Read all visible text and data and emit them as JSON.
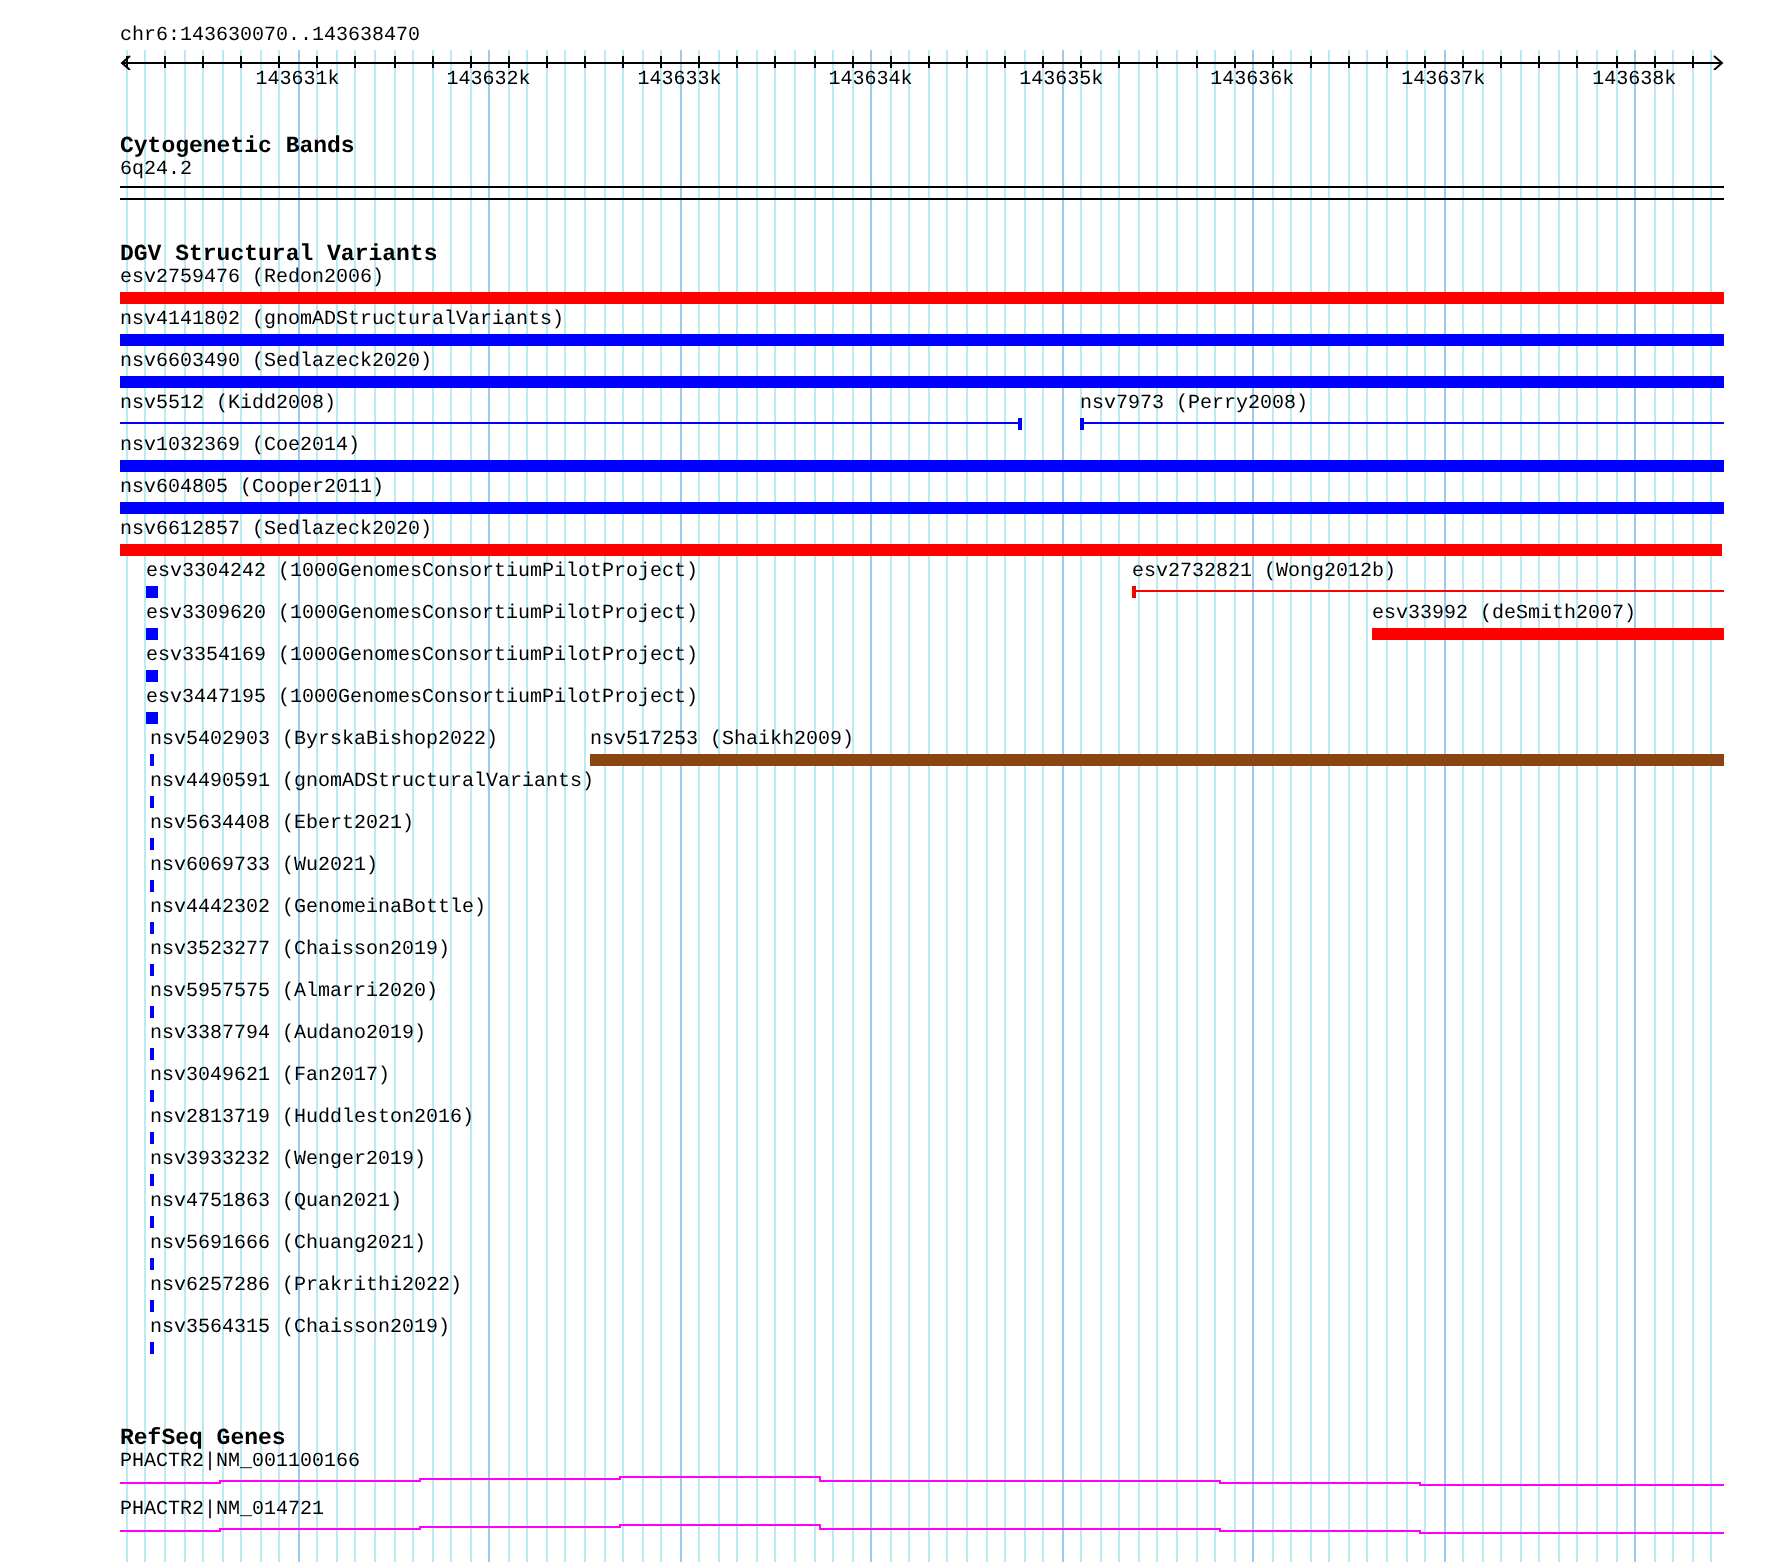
{
  "ruler": {
    "location": "chr6:143630070..143638470",
    "ticks": [
      "143631k",
      "143632k",
      "143633k",
      "143634k",
      "143635k",
      "143636k",
      "143637k",
      "143638k"
    ]
  },
  "cytogenetic_bands": {
    "title": "Cytogenetic Bands",
    "items": [
      "6q24.2"
    ]
  },
  "variants": {
    "title": "DGV Structural Variants",
    "rows": [
      {
        "features": [
          {
            "label": "esv2759476 (Redon2006)",
            "kind": "bar",
            "color": "#ff0000"
          }
        ]
      },
      {
        "features": [
          {
            "label": "nsv4141802 (gnomADStructuralVariants)",
            "kind": "bar",
            "color": "#0000ff"
          }
        ]
      },
      {
        "features": [
          {
            "label": "nsv6603490 (Sedlazeck2020)",
            "kind": "bar",
            "color": "#0000ff"
          }
        ]
      },
      {
        "features": [
          {
            "label": "nsv5512 (Kidd2008)",
            "kind": "line",
            "color": "#0000ff"
          },
          {
            "label": "nsv7973 (Perry2008)",
            "kind": "line",
            "color": "#0000ff"
          }
        ]
      },
      {
        "features": [
          {
            "label": "nsv1032369 (Coe2014)",
            "kind": "bar",
            "color": "#0000ff"
          }
        ]
      },
      {
        "features": [
          {
            "label": "nsv604805 (Cooper2011)",
            "kind": "bar",
            "color": "#0000ff"
          }
        ]
      },
      {
        "features": [
          {
            "label": "nsv6612857 (Sedlazeck2020)",
            "kind": "bar",
            "color": "#ff0000"
          }
        ]
      },
      {
        "features": [
          {
            "label": "esv3304242 (1000GenomesConsortiumPilotProject)",
            "kind": "point",
            "color": "#0000ff"
          },
          {
            "label": "esv2732821 (Wong2012b)",
            "kind": "line",
            "color": "#ff0000"
          }
        ]
      },
      {
        "features": [
          {
            "label": "esv3309620 (1000GenomesConsortiumPilotProject)",
            "kind": "point",
            "color": "#0000ff"
          },
          {
            "label": "esv33992 (deSmith2007)",
            "kind": "bar",
            "color": "#ff0000"
          }
        ]
      },
      {
        "features": [
          {
            "label": "esv3354169 (1000GenomesConsortiumPilotProject)",
            "kind": "point",
            "color": "#0000ff"
          }
        ]
      },
      {
        "features": [
          {
            "label": "esv3447195 (1000GenomesConsortiumPilotProject)",
            "kind": "point",
            "color": "#0000ff"
          }
        ]
      },
      {
        "features": [
          {
            "label": "nsv5402903 (ByrskaBishop2022)",
            "kind": "mark",
            "color": "#0000ff"
          },
          {
            "label": "nsv517253 (Shaikh2009)",
            "kind": "bar",
            "color": "#8b4513"
          }
        ]
      },
      {
        "features": [
          {
            "label": "nsv4490591 (gnomADStructuralVariants)",
            "kind": "mark",
            "color": "#0000ff"
          }
        ]
      },
      {
        "features": [
          {
            "label": "nsv5634408 (Ebert2021)",
            "kind": "mark",
            "color": "#0000ff"
          }
        ]
      },
      {
        "features": [
          {
            "label": "nsv6069733 (Wu2021)",
            "kind": "mark",
            "color": "#0000ff"
          }
        ]
      },
      {
        "features": [
          {
            "label": "nsv4442302 (GenomeinaBottle)",
            "kind": "mark",
            "color": "#0000ff"
          }
        ]
      },
      {
        "features": [
          {
            "label": "nsv3523277 (Chaisson2019)",
            "kind": "mark",
            "color": "#0000ff"
          }
        ]
      },
      {
        "features": [
          {
            "label": "nsv5957575 (Almarri2020)",
            "kind": "mark",
            "color": "#0000ff"
          }
        ]
      },
      {
        "features": [
          {
            "label": "nsv3387794 (Audano2019)",
            "kind": "mark",
            "color": "#0000ff"
          }
        ]
      },
      {
        "features": [
          {
            "label": "nsv3049621 (Fan2017)",
            "kind": "mark",
            "color": "#0000ff"
          }
        ]
      },
      {
        "features": [
          {
            "label": "nsv2813719 (Huddleston2016)",
            "kind": "mark",
            "color": "#0000ff"
          }
        ]
      },
      {
        "features": [
          {
            "label": "nsv3933232 (Wenger2019)",
            "kind": "mark",
            "color": "#0000ff"
          }
        ]
      },
      {
        "features": [
          {
            "label": "nsv4751863 (Quan2021)",
            "kind": "mark",
            "color": "#0000ff"
          }
        ]
      },
      {
        "features": [
          {
            "label": "nsv5691666 (Chuang2021)",
            "kind": "mark",
            "color": "#0000ff"
          }
        ]
      },
      {
        "features": [
          {
            "label": "nsv6257286 (Prakrithi2022)",
            "kind": "mark",
            "color": "#0000ff"
          }
        ]
      },
      {
        "features": [
          {
            "label": "nsv3564315 (Chaisson2019)",
            "kind": "mark",
            "color": "#0000ff"
          }
        ]
      }
    ]
  },
  "genes": {
    "title": "RefSeq Genes",
    "rows": [
      {
        "label": "PHACTR2|NM_001100166"
      },
      {
        "label": "PHACTR2|NM_014721"
      }
    ]
  }
}
